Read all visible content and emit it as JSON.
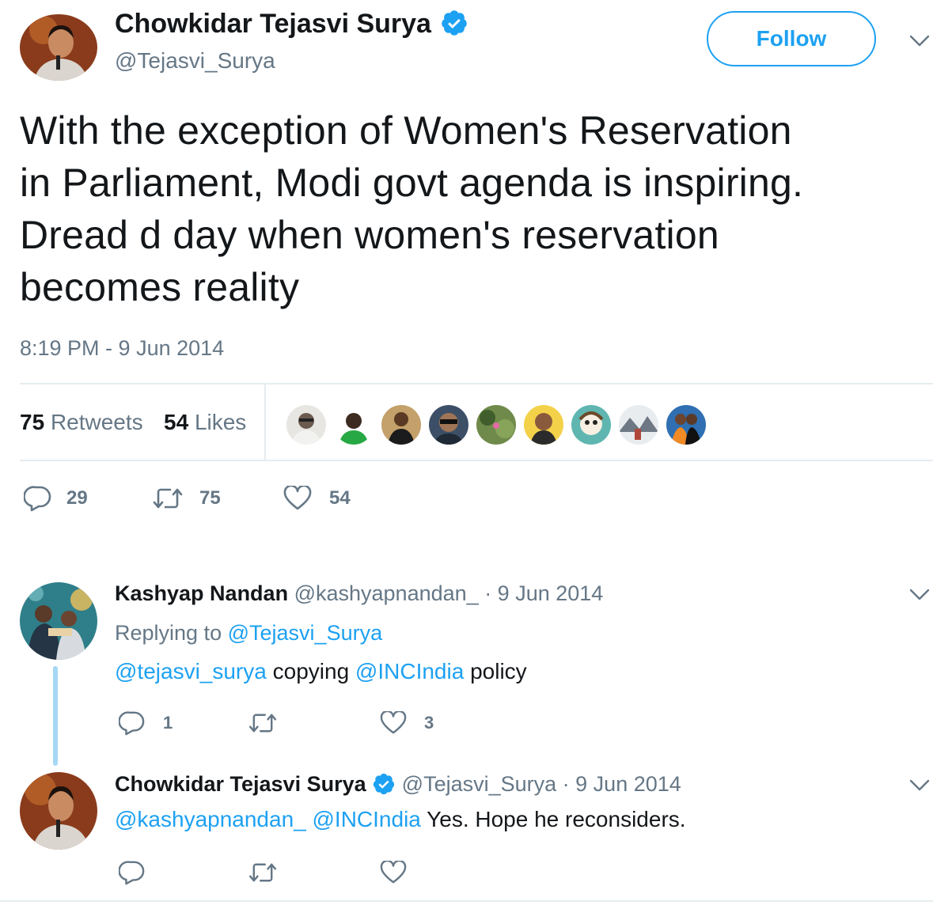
{
  "tweet": {
    "author_name": "Chowkidar Tejasvi Surya",
    "handle": "@Tejasvi_Surya",
    "follow_label": "Follow",
    "text_lines": [
      "With the exception of Women's Reservation",
      "in Parliament, Modi govt agenda is inspiring.",
      "Dread d day when women's reservation",
      "becomes reality"
    ],
    "timestamp": "8:19 PM - 9 Jun 2014",
    "retweets_count": "75",
    "retweets_label": "Retweets",
    "likes_count": "54",
    "likes_label": "Likes",
    "actions": {
      "replies": "29",
      "retweets": "75",
      "likes": "54"
    }
  },
  "replies": [
    {
      "author_name": "Kashyap Nandan",
      "handle": "@kashyapnandan_",
      "date": "· 9 Jun 2014",
      "replying_prefix": "Replying to",
      "replying_handle": "@Tejasvi_Surya",
      "mention_1": "@tejasvi_surya",
      "text_1": "copying",
      "mention_2": "@INCIndia",
      "text_2": "policy",
      "actions": {
        "replies": "1",
        "retweets": "",
        "likes": "3"
      }
    },
    {
      "author_name": "Chowkidar Tejasvi Surya",
      "handle": "@Tejasvi_Surya",
      "date": "· 9 Jun 2014",
      "mention_1": "@kashyapnandan_",
      "mention_2": "@INCIndia",
      "text": "Yes. Hope he reconsiders.",
      "actions": {
        "replies": "",
        "retweets": "",
        "likes": ""
      }
    }
  ],
  "colors": {
    "link": "#1da1f2",
    "secondary": "#657786",
    "divider": "#e6ecf0",
    "thread_line": "#a6d7f5"
  },
  "icons": [
    "verified-badge-icon",
    "chevron-down-icon",
    "reply-icon",
    "retweet-icon",
    "like-icon"
  ]
}
